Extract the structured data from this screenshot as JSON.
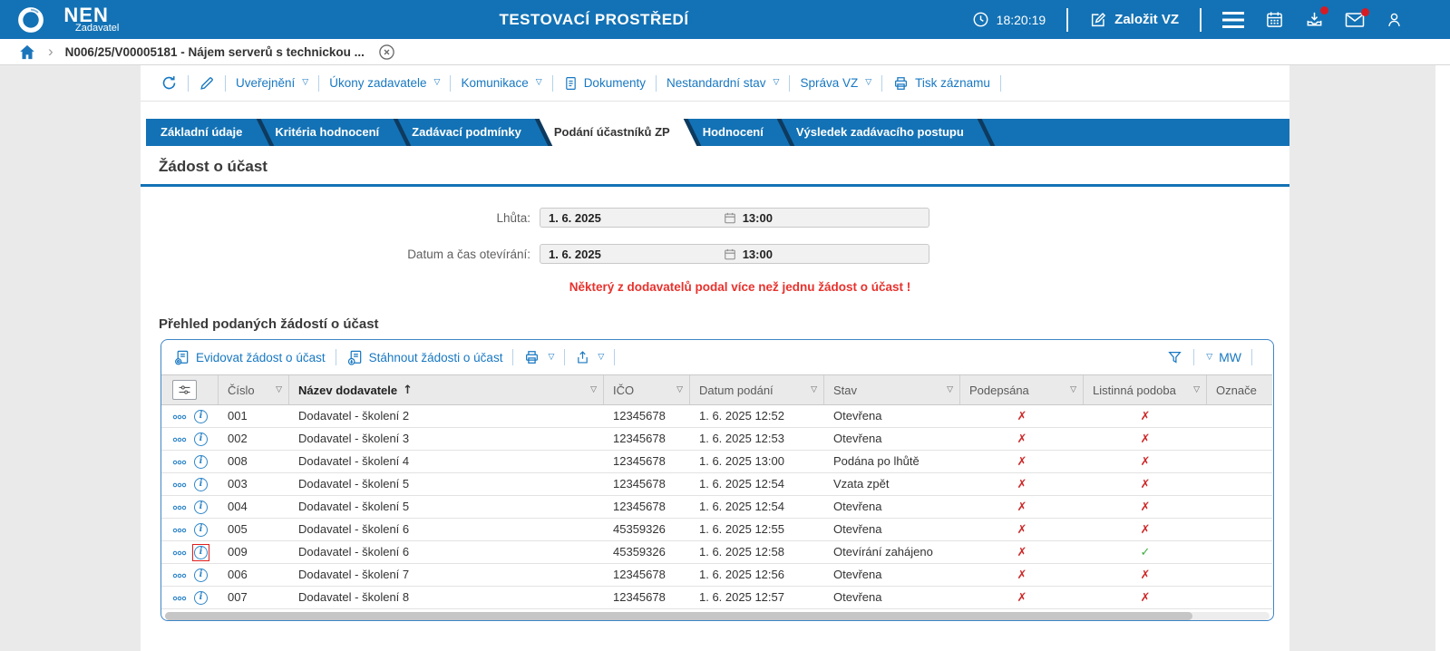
{
  "header": {
    "brand": "NEN",
    "brand_sub": "Zadavatel",
    "env_title": "TESTOVACÍ PROSTŘEDÍ",
    "clock": "18:20:19",
    "create_vz": "Založit VZ"
  },
  "breadcrumb": {
    "item": "N006/25/V00005181 - Nájem serverů s technickou ..."
  },
  "record_toolbar": [
    {
      "name": "refresh-button",
      "icon": "refresh"
    },
    {
      "name": "edit-button",
      "icon": "pencil"
    },
    {
      "name": "uverejneni-menu",
      "label": "Uveřejnění",
      "caret": true
    },
    {
      "name": "ukony-zadavatele-menu",
      "label": "Úkony zadavatele",
      "caret": true
    },
    {
      "name": "komunikace-menu",
      "label": "Komunikace",
      "caret": true
    },
    {
      "name": "dokumenty-button",
      "icon": "document",
      "label": "Dokumenty"
    },
    {
      "name": "nestandardni-stav-menu",
      "label": "Nestandardní stav",
      "caret": true
    },
    {
      "name": "sprava-vz-menu",
      "label": "Správa VZ",
      "caret": true
    },
    {
      "name": "tisk-zaznamu-button",
      "icon": "printer",
      "label": "Tisk záznamu"
    }
  ],
  "tabs": [
    {
      "name": "zakladni-udaje",
      "label": "Základní údaje",
      "active": false
    },
    {
      "name": "kriteria-hodnoceni",
      "label": "Kritéria hodnocení",
      "active": false
    },
    {
      "name": "zadavaci-podminky",
      "label": "Zadávací podmínky",
      "active": false
    },
    {
      "name": "podani-ucastniku-zp",
      "label": "Podání účastníků ZP",
      "active": true
    },
    {
      "name": "hodnoceni",
      "label": "Hodnocení",
      "active": false
    },
    {
      "name": "vysledek-zadavaciho-postupu",
      "label": "Výsledek zadávacího postupu",
      "active": false
    }
  ],
  "section": {
    "heading": "Žádost o účast"
  },
  "form": {
    "rows": [
      {
        "label": "Lhůta:",
        "date": "1. 6. 2025",
        "time": "13:00"
      },
      {
        "label": "Datum a čas otevírání:",
        "date": "1. 6. 2025",
        "time": "13:00"
      }
    ],
    "warning": "Některý z dodavatelů podal více než jednu žádost o účast !"
  },
  "grid": {
    "title": "Přehled podaných žádostí o účast",
    "toolbar": {
      "register": "Evidovat žádost o účast",
      "download": "Stáhnout žádosti o účast",
      "mw": "MW"
    },
    "columns": [
      {
        "key": "cislo",
        "label": "Číslo",
        "filter": true,
        "sorted": false
      },
      {
        "key": "nazev",
        "label": "Název dodavatele",
        "filter": true,
        "sorted": true,
        "sort_dir": "asc"
      },
      {
        "key": "ico",
        "label": "IČO",
        "filter": true,
        "sorted": false
      },
      {
        "key": "datum",
        "label": "Datum podání",
        "filter": true,
        "sorted": false
      },
      {
        "key": "stav",
        "label": "Stav",
        "filter": true,
        "sorted": false
      },
      {
        "key": "podepsana",
        "label": "Podepsána",
        "filter": true,
        "sorted": false
      },
      {
        "key": "listinna",
        "label": "Listinná podoba",
        "filter": true,
        "sorted": false
      },
      {
        "key": "oznac",
        "label": "Označe",
        "filter": false,
        "sorted": false
      }
    ],
    "rows": [
      {
        "cislo": "001",
        "nazev": "Dodavatel - školení 2",
        "ico": "12345678",
        "datum": "1. 6. 2025 12:52",
        "stav": "Otevřena",
        "podepsana": "no",
        "listinna": "no",
        "info_highlight": false
      },
      {
        "cislo": "002",
        "nazev": "Dodavatel - školení 3",
        "ico": "12345678",
        "datum": "1. 6. 2025 12:53",
        "stav": "Otevřena",
        "podepsana": "no",
        "listinna": "no",
        "info_highlight": false
      },
      {
        "cislo": "008",
        "nazev": "Dodavatel - školení 4",
        "ico": "12345678",
        "datum": "1. 6. 2025 13:00",
        "stav": "Podána po lhůtě",
        "podepsana": "no",
        "listinna": "no",
        "info_highlight": false
      },
      {
        "cislo": "003",
        "nazev": "Dodavatel - školení 5",
        "ico": "12345678",
        "datum": "1. 6. 2025 12:54",
        "stav": "Vzata zpět",
        "podepsana": "no",
        "listinna": "no",
        "info_highlight": false
      },
      {
        "cislo": "004",
        "nazev": "Dodavatel - školení 5",
        "ico": "12345678",
        "datum": "1. 6. 2025 12:54",
        "stav": "Otevřena",
        "podepsana": "no",
        "listinna": "no",
        "info_highlight": false
      },
      {
        "cislo": "005",
        "nazev": "Dodavatel - školení 6",
        "ico": "45359326",
        "datum": "1. 6. 2025 12:55",
        "stav": "Otevřena",
        "podepsana": "no",
        "listinna": "no",
        "info_highlight": false
      },
      {
        "cislo": "009",
        "nazev": "Dodavatel - školení 6",
        "ico": "45359326",
        "datum": "1. 6. 2025 12:58",
        "stav": "Otevírání zahájeno",
        "podepsana": "no",
        "listinna": "yes",
        "info_highlight": true
      },
      {
        "cislo": "006",
        "nazev": "Dodavatel - školení 7",
        "ico": "12345678",
        "datum": "1. 6. 2025 12:56",
        "stav": "Otevřena",
        "podepsana": "no",
        "listinna": "no",
        "info_highlight": false
      },
      {
        "cislo": "007",
        "nazev": "Dodavatel - školení 8",
        "ico": "12345678",
        "datum": "1. 6. 2025 12:57",
        "stav": "Otevřena",
        "podepsana": "no",
        "listinna": "no",
        "info_highlight": false
      }
    ]
  },
  "colors": {
    "brand_blue": "#1372b5",
    "tab_slash_navy": "#0e3a5f",
    "link_blue": "#1878c2",
    "warning_red": "#e8322d",
    "cross_red": "#cc2a2a",
    "check_green": "#3caf3f",
    "badge_red": "#d51c24"
  }
}
